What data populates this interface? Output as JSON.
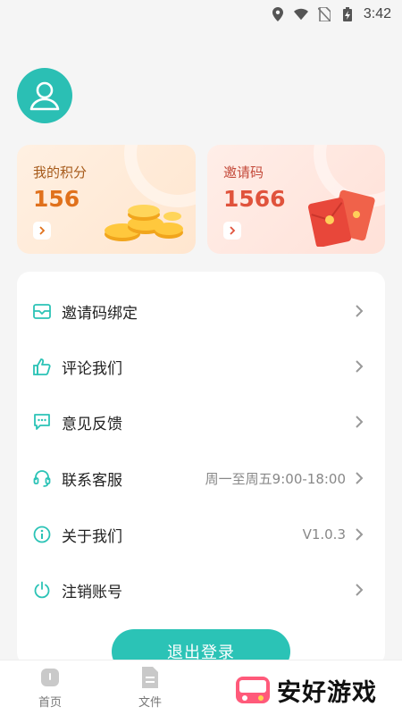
{
  "status_bar": {
    "time": "3:42"
  },
  "cards": {
    "points": {
      "title": "我的积分",
      "value": "156"
    },
    "invite": {
      "title": "邀请码",
      "value": "1566"
    }
  },
  "menu": {
    "items": [
      {
        "label": "邀请码绑定",
        "value": "",
        "icon": "envelope-icon"
      },
      {
        "label": "评论我们",
        "value": "",
        "icon": "thumbs-up-icon"
      },
      {
        "label": "意见反馈",
        "value": "",
        "icon": "chat-icon"
      },
      {
        "label": "联系客服",
        "value": "周一至周五9:00-18:00",
        "icon": "headset-icon"
      },
      {
        "label": "关于我们",
        "value": "V1.0.3",
        "icon": "info-icon"
      },
      {
        "label": "注销账号",
        "value": "",
        "icon": "power-icon"
      }
    ]
  },
  "logout": {
    "label": "退出登录"
  },
  "tabbar": {
    "tabs": [
      {
        "label": "首页",
        "icon": "home-icon"
      },
      {
        "label": "文件",
        "icon": "file-icon"
      }
    ]
  },
  "watermark": {
    "text": "安好游戏"
  },
  "colors": {
    "accent": "#2bc3b6",
    "points": "#e0711c",
    "invite": "#e0533c"
  }
}
